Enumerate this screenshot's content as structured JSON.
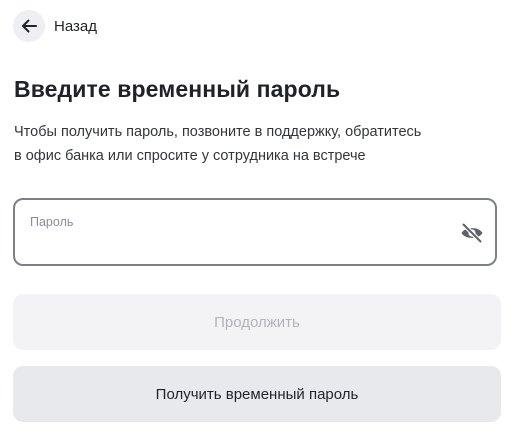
{
  "header": {
    "back_label": "Назад",
    "back_icon": "arrow-left-icon"
  },
  "main": {
    "title": "Введите временный пароль",
    "subtitle_line1": "Чтобы получить пароль, позвоните в поддержку, обратитесь",
    "subtitle_line2": "в офис банка или спросите у сотрудника на встрече"
  },
  "password_field": {
    "label": "Пароль",
    "value": "",
    "visibility_icon": "eye-off-icon"
  },
  "buttons": {
    "continue_label": "Продолжить",
    "continue_state": "disabled",
    "get_temp_label": "Получить временный пароль"
  },
  "colors": {
    "text_primary": "#1f2229",
    "field_border": "#7d8089",
    "disabled_button_bg": "#f3f3f5",
    "disabled_button_text": "#b2b4ba",
    "secondary_button_bg": "#e8e9ec"
  }
}
